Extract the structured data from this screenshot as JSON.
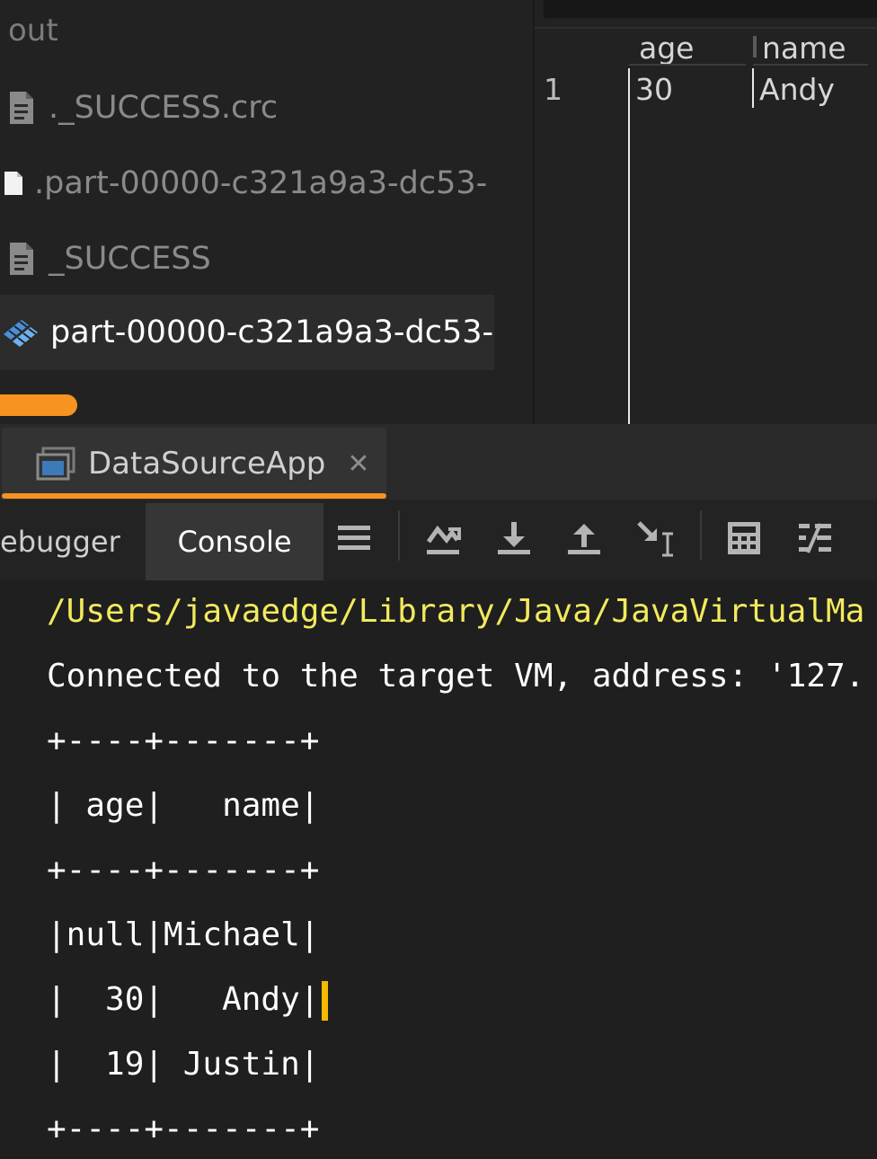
{
  "project_tree": {
    "folder": "out",
    "items": [
      {
        "name": "._SUCCESS.crc",
        "icon": "text-file-icon",
        "selected": false
      },
      {
        "name": ".part-00000-c321a9a3-dc53-",
        "icon": "blank-file-icon",
        "selected": false
      },
      {
        "name": "_SUCCESS",
        "icon": "text-file-icon",
        "selected": false
      },
      {
        "name": "part-00000-c321a9a3-dc53-",
        "icon": "parquet-file-icon",
        "selected": true
      }
    ]
  },
  "data_viewer": {
    "columns": [
      "age",
      "name"
    ],
    "rows": [
      {
        "num": "1",
        "age": "30",
        "name": "Andy"
      }
    ]
  },
  "run_window": {
    "tab_label": "DataSourceApp",
    "close_icon": "close-icon",
    "accent": "#f79321"
  },
  "debug_toolbar": {
    "tabs": [
      {
        "label": "ebugger",
        "active": false
      },
      {
        "label": "Console",
        "active": true
      }
    ],
    "icons": [
      "list-menu-icon",
      "show-execution-point-icon",
      "step-over-download-icon",
      "step-out-upload-icon",
      "run-to-cursor-icon",
      "evaluate-expression-calculator-icon",
      "trace-settings-icon"
    ]
  },
  "console": {
    "lines": [
      {
        "text": "/Users/javaedge/Library/Java/JavaVirtualMa",
        "kind": "path"
      },
      {
        "text": "Connected to the target VM, address: '127.",
        "kind": "normal"
      },
      {
        "text": "+----+-------+",
        "kind": "normal"
      },
      {
        "text": "| age|   name|",
        "kind": "normal"
      },
      {
        "text": "+----+-------+",
        "kind": "normal"
      },
      {
        "text": "|null|Michael|",
        "kind": "normal"
      },
      {
        "text": "|  30|   Andy|",
        "kind": "normal"
      },
      {
        "text": "|  19| Justin|",
        "kind": "normal"
      },
      {
        "text": "+----+-------+",
        "kind": "normal"
      }
    ],
    "path_color": "#f2ea5c",
    "caret_color": "#f7b800"
  }
}
